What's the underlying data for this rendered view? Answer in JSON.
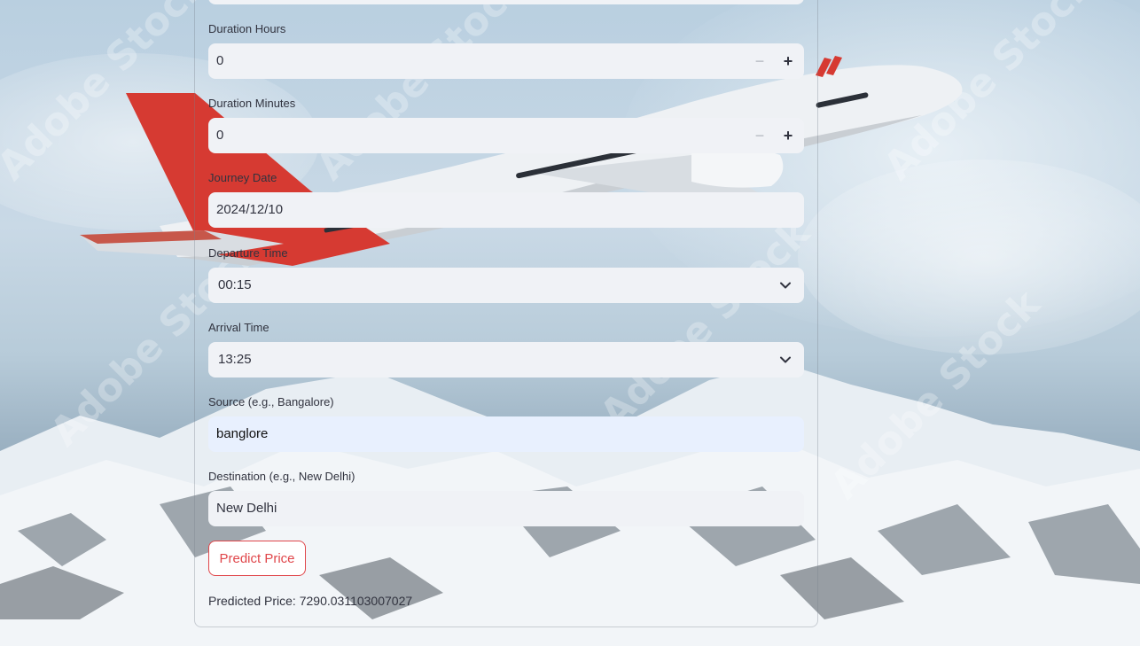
{
  "form": {
    "duration_hours": {
      "label": "Duration Hours",
      "value": "0"
    },
    "duration_minutes": {
      "label": "Duration Minutes",
      "value": "0"
    },
    "journey_date": {
      "label": "Journey Date",
      "value": "2024/12/10"
    },
    "departure_time": {
      "label": "Departure Time",
      "value": "00:15"
    },
    "arrival_time": {
      "label": "Arrival Time",
      "value": "13:25"
    },
    "source": {
      "label": "Source (e.g., Bangalore)",
      "value": "banglore"
    },
    "destination": {
      "label": "Destination (e.g., New Delhi)",
      "value": "New Delhi"
    },
    "stepper_minus": "−",
    "stepper_plus": "+"
  },
  "predict_button": {
    "label": "Predict Price"
  },
  "result": {
    "text": "Predicted Price: 7290.031103007027"
  },
  "background": {
    "watermark_text": "Adobe Stock"
  },
  "colors": {
    "accent": "#e0464a",
    "field_bg": "#f0f2f6",
    "active_field_bg": "#e8f0fe"
  }
}
